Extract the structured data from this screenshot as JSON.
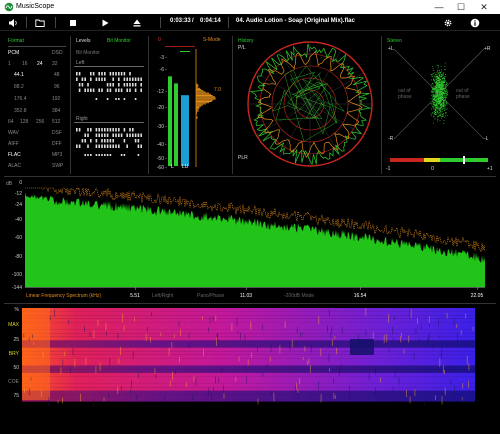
{
  "window": {
    "title": "MusicScope",
    "minimize_glyph": "—",
    "maximize_glyph": "☐",
    "close_glyph": "✕"
  },
  "toolbar": {
    "time_elapsed": "0:03:33",
    "time_separator": "/",
    "time_total": "0:04:14",
    "track": "04. Audio Lotion - Soap (Original Mix).flac",
    "icons": [
      "speaker-icon",
      "folder-icon",
      "stop-icon",
      "play-icon",
      "eject-icon",
      "gear-icon",
      "info-icon"
    ]
  },
  "format": {
    "title": "Format",
    "pcm": "PCM",
    "dsd": "DSD",
    "bits": [
      "1",
      "16",
      "24",
      "32"
    ],
    "bits_active": "24",
    "rates": [
      [
        "44.1",
        "48"
      ],
      [
        "88.2",
        "96"
      ],
      [
        "176.4",
        "192"
      ],
      [
        "352.8",
        "384"
      ]
    ],
    "rates_active": "44.1",
    "dsd_rates": [
      "64",
      "128",
      "256",
      "512"
    ],
    "containers": [
      [
        "WAV",
        "DSF"
      ],
      [
        "AIFF",
        "DFF"
      ],
      [
        "FLAC",
        "MP3"
      ],
      [
        "ALAC",
        "SWP"
      ]
    ],
    "container_active": "FLAC"
  },
  "levels": {
    "title": "Levels",
    "mode_label": "Bit Monitor",
    "bit_monitor_label": "Bit Monitor",
    "left_label": "Left",
    "right_label": "Right"
  },
  "meter": {
    "top_label": "0",
    "s_mode_label": "S-Mode",
    "scale": [
      "-3",
      "-6",
      "-12",
      "-20",
      "-30",
      "-40",
      "-50",
      "-60"
    ],
    "peak_label": "7.0",
    "l_label": "L",
    "lu_label": "LU",
    "left_level": 0.76,
    "right_level": 0.7,
    "lu_level": 0.6
  },
  "history": {
    "title": "History",
    "pl_label": "P/L",
    "plr_label": "PLR"
  },
  "stereo": {
    "title": "Stereo",
    "plus_l": "+L",
    "plus_r": "+R",
    "minus_l": "-R",
    "minus_r": "-L",
    "out_of_phase_left": "out of\nphase",
    "out_of_phase_right": "out of\nphase",
    "corr_left": "-1",
    "corr_mid": "0",
    "corr_right": "+1"
  },
  "spectrum": {
    "db_label": "dB",
    "y_ticks": [
      "0",
      "-12",
      "-24",
      "-40",
      "-60",
      "-80",
      "-100",
      "-144"
    ],
    "x_label": "Linear Frequency Spectrum (kHz)",
    "x_ticks": [
      "5.51",
      "11.03",
      "16.54",
      "22.05"
    ],
    "mode_left_right": "Left/Right",
    "mode_pano": "Pano/Phase",
    "mode_db": "-200dB Mode"
  },
  "spectrogram": {
    "y_ticks": [
      "%",
      "MAX",
      "25",
      "BRY",
      "50",
      "COE",
      "75"
    ]
  },
  "colors": {
    "green": "#2ecc2e",
    "orange": "#e08c1a",
    "spectrum_fill": "#22c41a",
    "meter_blue": "#1b9fd0",
    "red_ring": "#c8261e"
  }
}
